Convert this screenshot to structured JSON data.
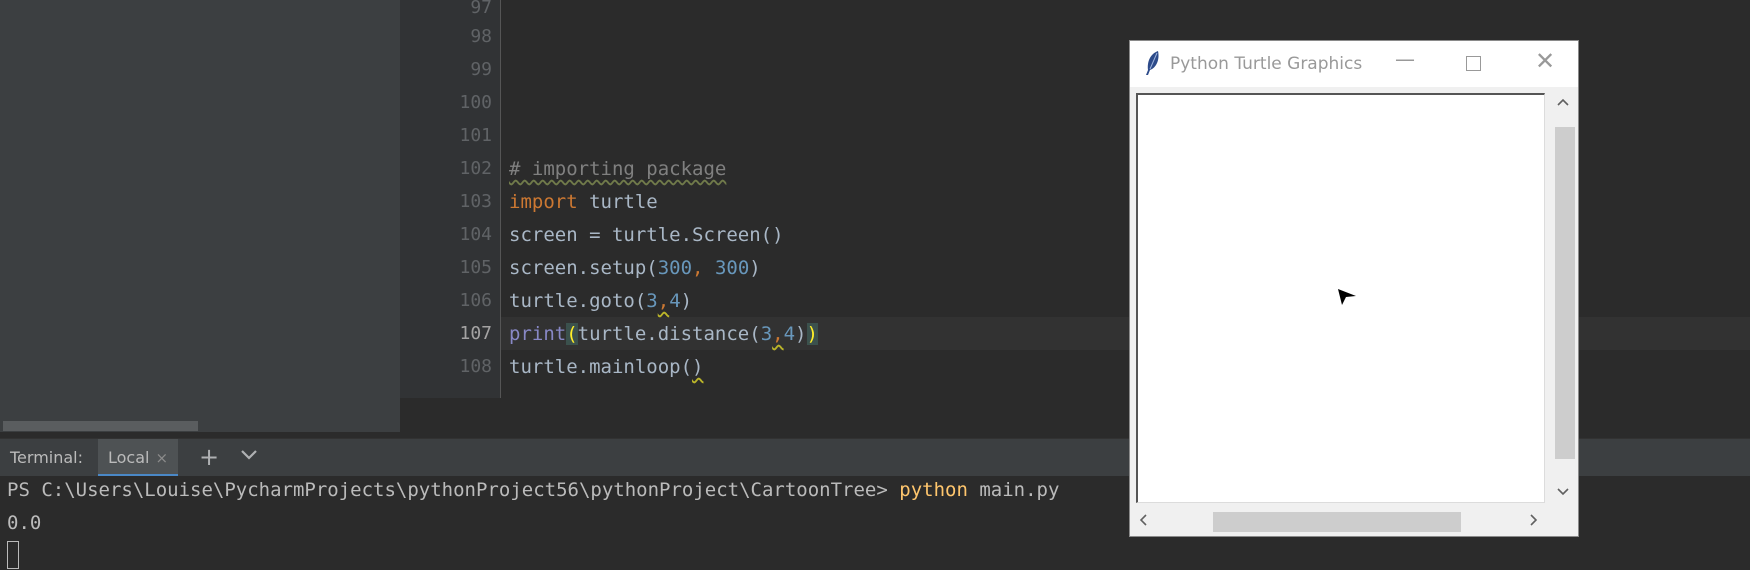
{
  "editor": {
    "line_numbers": [
      "97",
      "98",
      "99",
      "100",
      "101",
      "102",
      "103",
      "104",
      "105",
      "106",
      "107",
      "108"
    ],
    "lines": {
      "l102_comment": "# importing package",
      "l103_kw": "import",
      "l103_rest": " turtle",
      "l104": "screen = turtle.Screen()",
      "l105_a": "screen.setup(",
      "l105_n1": "300",
      "l105_c": ", ",
      "l105_n2": "300",
      "l105_b": ")",
      "l106_a": "turtle.goto(",
      "l106_n1": "3",
      "l106_c": ",",
      "l106_n2": "4",
      "l106_b": ")",
      "l107_bi": "print",
      "l107_p1": "(",
      "l107_a": "turtle.distance(",
      "l107_n1": "3",
      "l107_c": ",",
      "l107_n2": "4",
      "l107_b": ")",
      "l107_p2": ")",
      "l108_a": "turtle.mainloop(",
      "l108_b": ")"
    }
  },
  "terminal": {
    "label": "Terminal:",
    "tab_label": "Local",
    "tab_close": "×",
    "add": "+",
    "menu": "⌄",
    "prompt": "PS C:\\Users\\Louise\\PycharmProjects\\pythonProject56\\pythonProject\\CartoonTree> ",
    "command": "python",
    "args": " main.py",
    "output": "0.0"
  },
  "turtle_window": {
    "title": "Python Turtle Graphics",
    "minimize": "—",
    "close": "✕"
  },
  "colors": {
    "keyword": "#cc7832",
    "number": "#6897bb",
    "builtin": "#8888c6",
    "comment": "#808080",
    "bracket_highlight": "#ffef28"
  }
}
